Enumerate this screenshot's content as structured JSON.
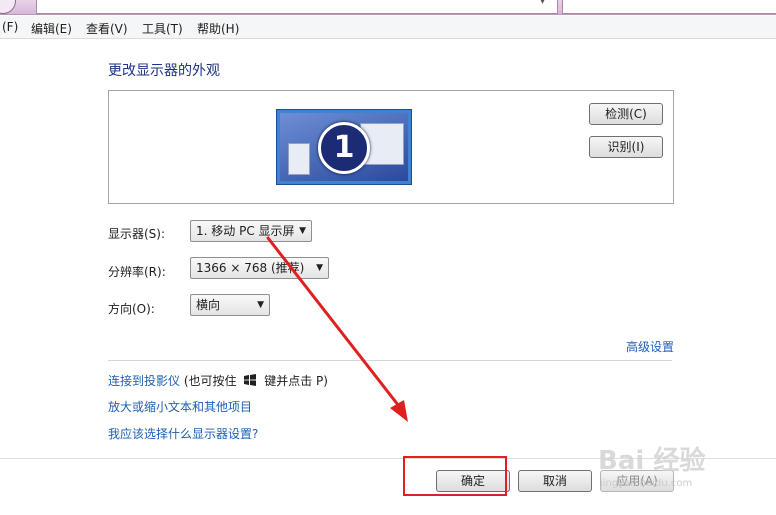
{
  "menu": {
    "file": "(F)",
    "edit": "编辑(E)",
    "view": "查看(V)",
    "tools": "工具(T)",
    "help": "帮助(H)"
  },
  "page": {
    "title": "更改显示器的外观"
  },
  "preview": {
    "monitor_number": "1",
    "detect_button": "检测(C)",
    "identify_button": "识别(I)"
  },
  "form": {
    "display_label": "显示器(S):",
    "display_value": "1. 移动 PC 显示屏",
    "resolution_label": "分辨率(R):",
    "resolution_value": "1366 × 768 (推荐)",
    "orientation_label": "方向(O):",
    "orientation_value": "横向"
  },
  "links": {
    "advanced": "高级设置",
    "projector": "连接到投影仪",
    "projector_hint_a": "(也可按住",
    "projector_hint_b": "键并点击 P)",
    "text_size": "放大或缩小文本和其他项目",
    "which_settings": "我应该选择什么显示器设置?"
  },
  "buttons": {
    "ok": "确定",
    "cancel": "取消",
    "apply": "应用(A)"
  },
  "watermark": {
    "main": "Bai 经验",
    "sub": "jingyan.baidu.com"
  },
  "colors": {
    "annotation_red": "#e02020",
    "link_blue": "#1e5fb4",
    "title_blue": "#1e3287"
  }
}
